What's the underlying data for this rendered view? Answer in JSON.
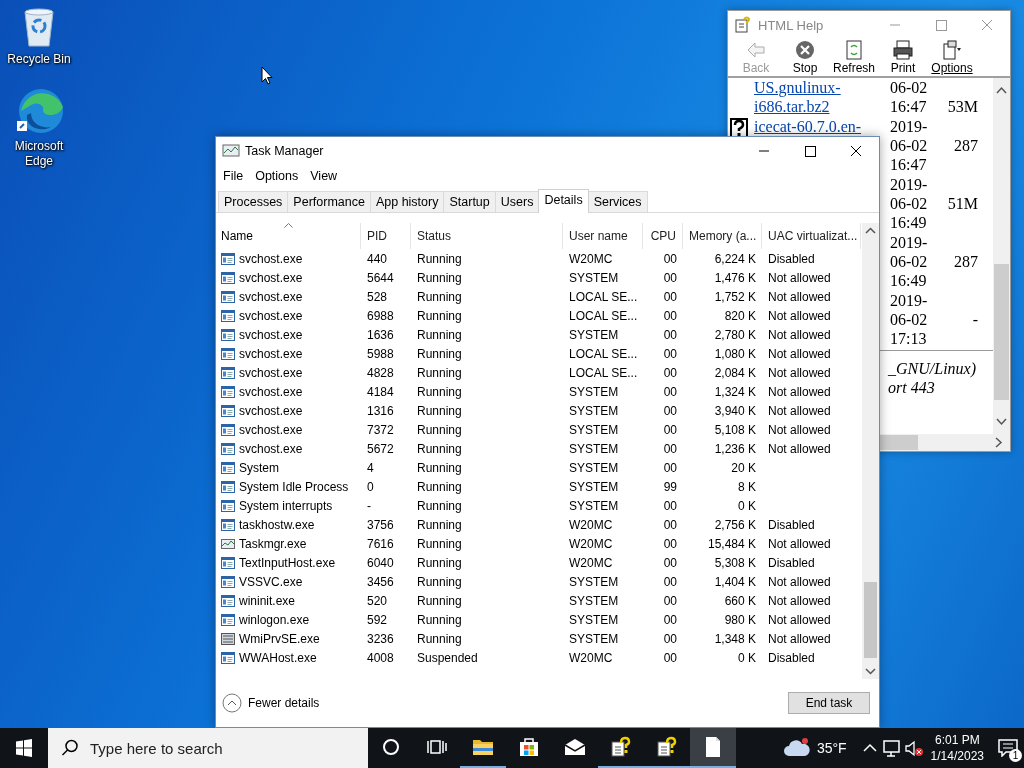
{
  "desktop": {
    "icons": [
      {
        "label": "Recycle Bin",
        "kind": "recycle"
      },
      {
        "label": "Microsoft Edge",
        "kind": "edge"
      }
    ]
  },
  "help_window": {
    "title": "HTML Help",
    "toolbar": [
      {
        "label": "Back",
        "kind": "back",
        "disabled": true
      },
      {
        "label": "Stop",
        "kind": "stop",
        "disabled": false
      },
      {
        "label": "Refresh",
        "kind": "refresh",
        "disabled": false
      },
      {
        "label": "Print",
        "kind": "print",
        "disabled": false
      },
      {
        "label": "Options",
        "kind": "options",
        "disabled": false
      }
    ],
    "files": [
      {
        "kind": "plain",
        "name": "US.gnulinux-i686.tar.bz2",
        "date": [
          "06-02",
          "16:47"
        ],
        "size": "53M"
      },
      {
        "kind": "help",
        "name": "icecat-60.7.0.en-",
        "date": [
          "2019-",
          "06-02",
          "16:47"
        ],
        "size": "287"
      },
      {
        "kind": "plain",
        "date": [
          "2019-",
          "06-02",
          "16:49"
        ],
        "size": "51M"
      },
      {
        "kind": "plain",
        "date": [
          "2019-",
          "06-02",
          "16:49"
        ],
        "size": "287"
      },
      {
        "kind": "plain",
        "date": [
          "2019-",
          "06-02",
          "17:13"
        ],
        "size": "-"
      }
    ],
    "notes": [
      "_GNU/Linux)",
      "ort 443"
    ]
  },
  "task_manager": {
    "title": "Task Manager",
    "menu": [
      "File",
      "Options",
      "View"
    ],
    "tabs": [
      {
        "label": "Processes",
        "selected": false
      },
      {
        "label": "Performance",
        "selected": false
      },
      {
        "label": "App history",
        "selected": false
      },
      {
        "label": "Startup",
        "selected": false
      },
      {
        "label": "Users",
        "selected": false
      },
      {
        "label": "Details",
        "selected": true
      },
      {
        "label": "Services",
        "selected": false
      }
    ],
    "columns": [
      {
        "label": "Name",
        "sorted": true
      },
      {
        "label": "PID",
        "sorted": false
      },
      {
        "label": "Status",
        "sorted": false
      },
      {
        "label": "User name",
        "sorted": false
      },
      {
        "label": "CPU",
        "sorted": false
      },
      {
        "label": "Memory (a...",
        "sorted": false
      },
      {
        "label": "UAC virtualizat...",
        "sorted": false
      }
    ],
    "rows": [
      {
        "kind": "app",
        "name": "svchost.exe",
        "pid": "440",
        "status": "Running",
        "user": "W20MC",
        "cpu": "00",
        "memory": "6,224 K",
        "uac": "Disabled"
      },
      {
        "kind": "app",
        "name": "svchost.exe",
        "pid": "5644",
        "status": "Running",
        "user": "SYSTEM",
        "cpu": "00",
        "memory": "1,476 K",
        "uac": "Not allowed"
      },
      {
        "kind": "app",
        "name": "svchost.exe",
        "pid": "528",
        "status": "Running",
        "user": "LOCAL SE...",
        "cpu": "00",
        "memory": "1,752 K",
        "uac": "Not allowed"
      },
      {
        "kind": "app",
        "name": "svchost.exe",
        "pid": "6988",
        "status": "Running",
        "user": "LOCAL SE...",
        "cpu": "00",
        "memory": "820 K",
        "uac": "Not allowed"
      },
      {
        "kind": "app",
        "name": "svchost.exe",
        "pid": "1636",
        "status": "Running",
        "user": "SYSTEM",
        "cpu": "00",
        "memory": "2,780 K",
        "uac": "Not allowed"
      },
      {
        "kind": "app",
        "name": "svchost.exe",
        "pid": "5988",
        "status": "Running",
        "user": "LOCAL SE...",
        "cpu": "00",
        "memory": "1,080 K",
        "uac": "Not allowed"
      },
      {
        "kind": "app",
        "name": "svchost.exe",
        "pid": "4828",
        "status": "Running",
        "user": "LOCAL SE...",
        "cpu": "00",
        "memory": "2,084 K",
        "uac": "Not allowed"
      },
      {
        "kind": "app",
        "name": "svchost.exe",
        "pid": "4184",
        "status": "Running",
        "user": "SYSTEM",
        "cpu": "00",
        "memory": "1,324 K",
        "uac": "Not allowed"
      },
      {
        "kind": "app",
        "name": "svchost.exe",
        "pid": "1316",
        "status": "Running",
        "user": "SYSTEM",
        "cpu": "00",
        "memory": "3,940 K",
        "uac": "Not allowed"
      },
      {
        "kind": "app",
        "name": "svchost.exe",
        "pid": "7372",
        "status": "Running",
        "user": "SYSTEM",
        "cpu": "00",
        "memory": "5,108 K",
        "uac": "Not allowed"
      },
      {
        "kind": "app",
        "name": "svchost.exe",
        "pid": "5672",
        "status": "Running",
        "user": "SYSTEM",
        "cpu": "00",
        "memory": "1,236 K",
        "uac": "Not allowed"
      },
      {
        "kind": "app",
        "name": "System",
        "pid": "4",
        "status": "Running",
        "user": "SYSTEM",
        "cpu": "00",
        "memory": "20 K"
      },
      {
        "kind": "app",
        "name": "System Idle Process",
        "pid": "0",
        "status": "Running",
        "user": "SYSTEM",
        "cpu": "99",
        "memory": "8 K"
      },
      {
        "kind": "app",
        "name": "System interrupts",
        "pid": "-",
        "status": "Running",
        "user": "SYSTEM",
        "cpu": "00",
        "memory": "0 K"
      },
      {
        "kind": "app",
        "name": "taskhostw.exe",
        "pid": "3756",
        "status": "Running",
        "user": "W20MC",
        "cpu": "00",
        "memory": "2,756 K",
        "uac": "Disabled"
      },
      {
        "kind": "monitor",
        "name": "Taskmgr.exe",
        "pid": "7616",
        "status": "Running",
        "user": "W20MC",
        "cpu": "00",
        "memory": "15,484 K",
        "uac": "Not allowed"
      },
      {
        "kind": "app",
        "name": "TextInputHost.exe",
        "pid": "6040",
        "status": "Running",
        "user": "W20MC",
        "cpu": "00",
        "memory": "5,308 K",
        "uac": "Disabled"
      },
      {
        "kind": "app",
        "name": "VSSVC.exe",
        "pid": "3456",
        "status": "Running",
        "user": "SYSTEM",
        "cpu": "00",
        "memory": "1,404 K",
        "uac": "Not allowed"
      },
      {
        "kind": "app",
        "name": "wininit.exe",
        "pid": "520",
        "status": "Running",
        "user": "SYSTEM",
        "cpu": "00",
        "memory": "660 K",
        "uac": "Not allowed"
      },
      {
        "kind": "app",
        "name": "winlogon.exe",
        "pid": "592",
        "status": "Running",
        "user": "SYSTEM",
        "cpu": "00",
        "memory": "980 K",
        "uac": "Not allowed"
      },
      {
        "kind": "server",
        "name": "WmiPrvSE.exe",
        "pid": "3236",
        "status": "Running",
        "user": "SYSTEM",
        "cpu": "00",
        "memory": "1,348 K",
        "uac": "Not allowed"
      },
      {
        "kind": "app",
        "name": "WWAHost.exe",
        "pid": "4008",
        "status": "Suspended",
        "user": "W20MC",
        "cpu": "00",
        "memory": "0 K",
        "uac": "Disabled"
      }
    ],
    "fewer_details": "Fewer details",
    "end_task": "End task"
  },
  "taskbar": {
    "search_placeholder": "Type here to search",
    "apps": [
      {
        "kind": "cortana",
        "running": false,
        "active": false
      },
      {
        "kind": "taskview",
        "running": false,
        "active": false
      },
      {
        "kind": "folder",
        "running": true,
        "active": false
      },
      {
        "kind": "store",
        "running": false,
        "active": false
      },
      {
        "kind": "mail",
        "running": false,
        "active": false
      },
      {
        "kind": "help",
        "running": true,
        "active": false
      },
      {
        "kind": "help",
        "running": true,
        "active": false
      },
      {
        "kind": "document",
        "running": true,
        "active": true
      }
    ],
    "temperature": "35°F",
    "time": "6:01 PM",
    "date": "1/14/2023",
    "notifications": "1"
  }
}
